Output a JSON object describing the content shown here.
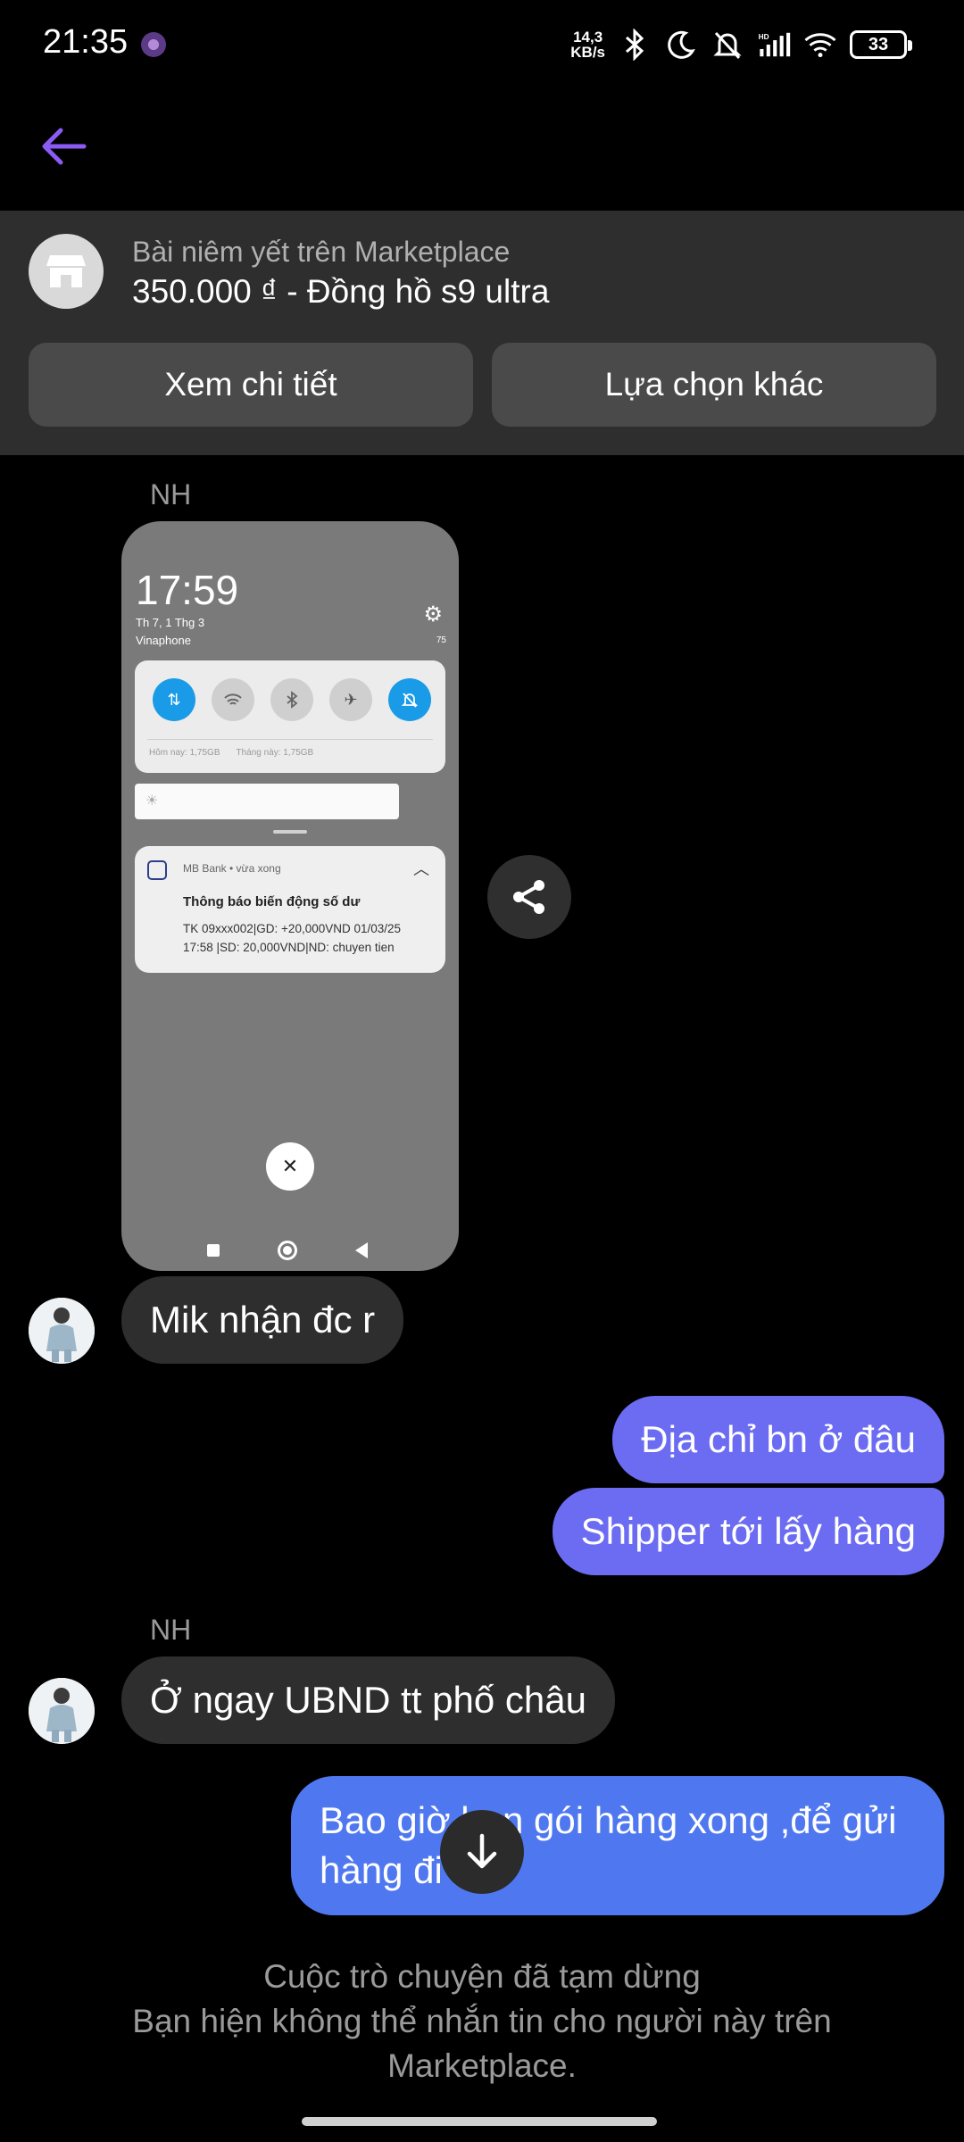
{
  "status_bar": {
    "time": "21:35",
    "net_speed_top": "14,3",
    "net_speed_bottom": "KB/s",
    "battery": "33"
  },
  "header": {
    "back_icon": "arrow-left-icon"
  },
  "listing": {
    "subtitle": "Bài niêm yết trên Marketplace",
    "title": "350.000 ₫ - Đồng hồ s9 ultra",
    "view_details": "Xem chi tiết",
    "other_options": "Lựa chọn khác"
  },
  "messages": {
    "sender_initials_1": "NH",
    "sender_initials_2": "NH",
    "received_1": "Mik nhận đc r",
    "sent_1": "Địa chỉ bn ở đâu",
    "sent_2": "Shipper tới lấy hàng",
    "received_2": "Ở ngay UBND tt phố châu",
    "sent_3_line1": "Bao giờ bạn gói hàng xong ,để  gửi",
    "sent_3_line2": "hàng đi"
  },
  "screenshot": {
    "time": "17:59",
    "date": "Th 7, 1 Thg 3",
    "carrier": "Vinaphone",
    "battery": "75",
    "usage_today": "Hôm nay: 1,75GB",
    "usage_month": "Tháng này: 1,75GB",
    "notif_app": "MB Bank • vừa xong",
    "notif_title": "Thông báo biến động số dư",
    "notif_line1": "TK 09xxx002|GD: +20,000VND 01/03/25",
    "notif_line2": "17:58 |SD: 20,000VND|ND: chuyen tien"
  },
  "footer": {
    "paused_title": "Cuộc trò chuyện đã tạm dừng",
    "paused_line2": "Bạn hiện không thể nhắn tin cho người này trên",
    "paused_line3": "Marketplace."
  },
  "colors": {
    "background": "#000000",
    "accent": "#8a5cf5",
    "bubble_incoming": "#2e2e2e",
    "bubble_outgoing_purple": "#6c6cf2",
    "bubble_outgoing_blue": "#4f78f0"
  }
}
